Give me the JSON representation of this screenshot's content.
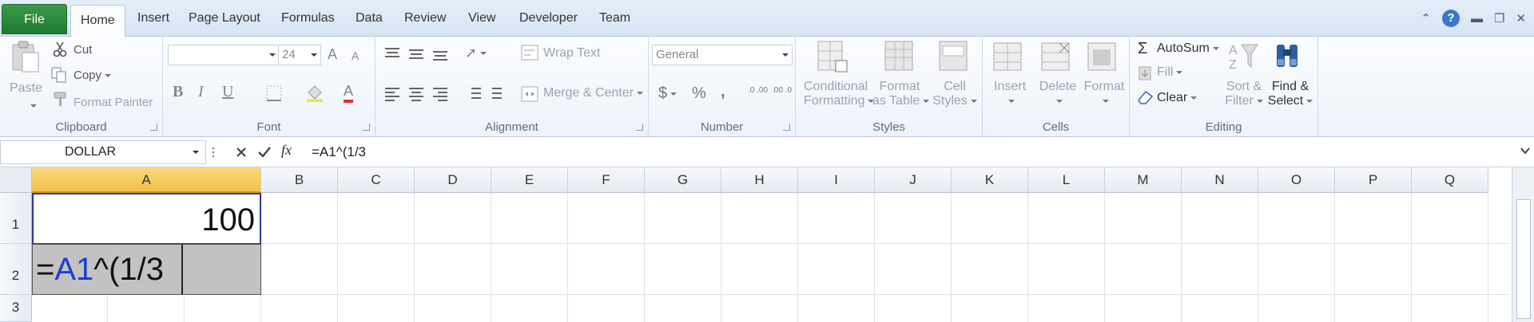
{
  "tabs": {
    "file": "File",
    "items": [
      "Home",
      "Insert",
      "Page Layout",
      "Formulas",
      "Data",
      "Review",
      "View",
      "Developer",
      "Team"
    ]
  },
  "window": {
    "help": "?"
  },
  "ribbon": {
    "clipboard": {
      "label": "Clipboard",
      "paste": "Paste",
      "cut": "Cut",
      "copy": "Copy",
      "format_painter": "Format Painter"
    },
    "font": {
      "label": "Font",
      "font_name": "",
      "font_size": "24",
      "bold": "B",
      "italic": "I",
      "underline": "U",
      "grow": "A",
      "shrink": "A",
      "font_color": "A"
    },
    "alignment": {
      "label": "Alignment",
      "wrap_text": "Wrap Text",
      "merge_center": "Merge & Center"
    },
    "number": {
      "label": "Number",
      "format": "General",
      "currency": "$",
      "percent": "%",
      "comma": ",",
      "inc_decimal": ".0 .00",
      "dec_decimal": ".00 .0"
    },
    "styles": {
      "label": "Styles",
      "conditional": [
        "Conditional",
        "Formatting"
      ],
      "format_table": [
        "Format",
        "as Table"
      ],
      "cell_styles": [
        "Cell",
        "Styles"
      ]
    },
    "cells": {
      "label": "Cells",
      "insert": "Insert",
      "delete": "Delete",
      "format": "Format"
    },
    "editing": {
      "label": "Editing",
      "autosum": "AutoSum",
      "fill": "Fill",
      "clear": "Clear",
      "sort_filter": [
        "Sort &",
        "Filter"
      ],
      "find_select": [
        "Find &",
        "Select"
      ]
    }
  },
  "formula_bar": {
    "name_box": "DOLLAR",
    "fx": "fx",
    "formula": "=A1^(1/3"
  },
  "grid": {
    "columns": [
      "A",
      "B",
      "C",
      "D",
      "E",
      "F",
      "G",
      "H",
      "I",
      "J",
      "K",
      "L",
      "M",
      "N",
      "O",
      "P",
      "Q"
    ],
    "rows": [
      "1",
      "2",
      "3"
    ],
    "a1_value": "100",
    "a2_edit": {
      "prefix": "=",
      "ref": "A1",
      "suffix": "^(1/3"
    }
  }
}
